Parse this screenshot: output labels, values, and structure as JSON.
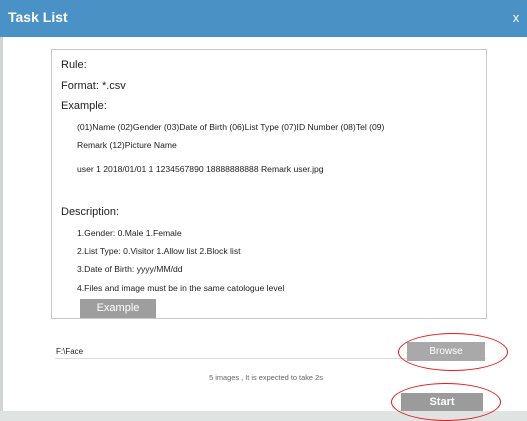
{
  "window": {
    "title": "Task List",
    "close_label": "x"
  },
  "rules": {
    "heading": "Rule:",
    "format": "Format: *.csv",
    "example_heading": "Example:",
    "columns_line1": "(01)Name  (02)Gender  (03)Date of Birth  (06)List Type  (07)ID Number  (08)Tel  (09)",
    "columns_line2": "Remark  (12)Picture Name",
    "sample_row": "user  1  2018/01/01  1  1234567890  18888888888  Remark  user.jpg",
    "description_heading": "Description:",
    "descriptions": [
      "1.Gender: 0.Male 1.Female",
      "2.List Type: 0.Visitor 1.Allow list 2.Block list",
      "3.Date of Birth: yyyy/MM/dd",
      "4.Files and image must be in the same catologue level"
    ],
    "example_button": "Example"
  },
  "import": {
    "path_value": "F:\\Face",
    "browse_button": "Browse",
    "info": "5 images , It is expected to take 2s",
    "start_button": "Start"
  },
  "colors": {
    "titlebar": "#4a92c6",
    "button_gray": "#9e9e9e",
    "highlight_red": "#e01c1c"
  }
}
